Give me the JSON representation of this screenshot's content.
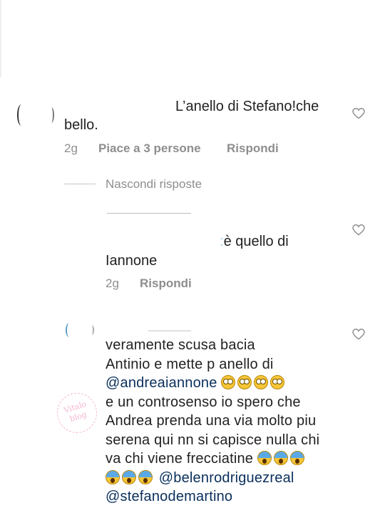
{
  "comment1": {
    "text_line1": "L’anello di Stefano!che",
    "text_line2": "bello.",
    "time": "2g",
    "likes": "Piace a 3 persone",
    "reply": "Rispondi"
  },
  "hide_replies": "Nascondi risposte",
  "reply1": {
    "text_line1": "è quello di",
    "text_line2": "Iannone",
    "time": "2g",
    "reply": "Rispondi"
  },
  "reply2": {
    "lines": [
      "veramente scusa bacia",
      "Antinio e mette p anello di"
    ],
    "mention1": "@andreaiannone",
    "lines2": [
      "e un controsenso io spero che",
      "Andrea prenda una via molto piu",
      "serena qui nn si capisce nulla chi"
    ],
    "line_frecciatine": "va chi viene  frecciatine",
    "mention2": "@belenrodriguezreal",
    "mention3": "@stefanodemartino"
  },
  "watermark_text": "Vitalo\nblog"
}
